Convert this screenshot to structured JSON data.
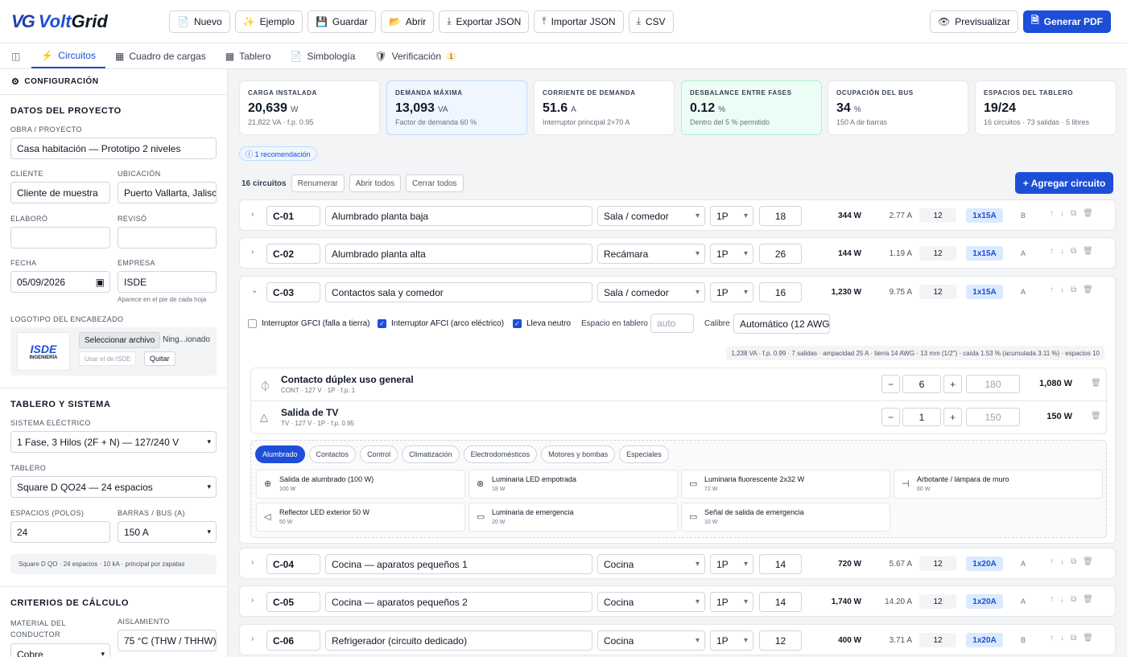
{
  "brand": {
    "mark": "VG",
    "name_a": "Volt",
    "name_b": "Grid"
  },
  "toolbar": [
    {
      "icon": "📄",
      "label": "Nuevo"
    },
    {
      "icon": "✨",
      "label": "Ejemplo"
    },
    {
      "icon": "💾",
      "label": "Guardar"
    },
    {
      "icon": "📂",
      "label": "Abrir"
    },
    {
      "icon": "⤓",
      "label": "Exportar JSON"
    },
    {
      "icon": "⤒",
      "label": "Importar JSON"
    },
    {
      "icon": "⤓",
      "label": "CSV"
    }
  ],
  "toolbar_right": {
    "preview": "Previsualizar",
    "pdf": "Generar PDF"
  },
  "tabs": [
    {
      "icon": "⚡",
      "label": "Circuitos"
    },
    {
      "icon": "▦",
      "label": "Cuadro de cargas"
    },
    {
      "icon": "▦",
      "label": "Tablero"
    },
    {
      "icon": "📄",
      "label": "Simbología"
    },
    {
      "icon": "🛡",
      "label": "Verificación",
      "badge": "1"
    }
  ],
  "sidebar": {
    "header": "CONFIGURACIÓN",
    "proyecto_title": "DATOS DEL PROYECTO",
    "obra_label": "OBRA / PROYECTO",
    "obra": "Casa habitación — Prototipo 2 niveles",
    "cliente_label": "CLIENTE",
    "cliente": "Cliente de muestra",
    "ubicacion_label": "UBICACIÓN",
    "ubicacion": "Puerto Vallarta, Jalisco",
    "elaboro_label": "ELABORÓ",
    "elaboro": "",
    "reviso_label": "REVISÓ",
    "reviso": "",
    "fecha_label": "FECHA",
    "fecha": "05/09/2026",
    "empresa_label": "EMPRESA",
    "empresa": "ISDE",
    "empresa_hint": "Aparece en el pie de cada hoja",
    "logo_label": "LOGOTIPO DEL ENCABEZADO",
    "logo_text": "ISDE",
    "logo_sub": "INGENIERÍA",
    "file_btn": "Seleccionar archivo",
    "file_name": "Ning...ionado",
    "use_isde": "Usar el de ISDE",
    "quitar": "Quitar",
    "tablero_title": "TABLERO Y SISTEMA",
    "sistema_label": "SISTEMA ELÉCTRICO",
    "sistema": "1 Fase, 3 Hilos (2F + N) — 127/240 V",
    "tablero_label": "TABLERO",
    "tablero": "Square D QO24 — 24 espacios",
    "espacios_label": "ESPACIOS (POLOS)",
    "espacios": "24",
    "barras_label": "BARRAS / BUS (A)",
    "barras": "150 A",
    "tablero_note": "Square D QO · 24 espacios · 10 kA · principal por zapatas",
    "criterios_title": "CRITERIOS DE CÁLCULO",
    "material_label": "MATERIAL DEL CONDUCTOR",
    "material": "Cobre",
    "aislamiento_label": "AISLAMIENTO",
    "aislamiento": "75 °C (THW / THHW)"
  },
  "stats": [
    {
      "title": "CARGA INSTALADA",
      "value": "20,639",
      "unit": "W",
      "sub": "21,822 VA · f.p. 0.95",
      "style": ""
    },
    {
      "title": "DEMANDA MÁXIMA",
      "value": "13,093",
      "unit": "VA",
      "sub": "Factor de demanda 60 %",
      "style": "blue"
    },
    {
      "title": "CORRIENTE DE DEMANDA",
      "value": "51.6",
      "unit": "A",
      "sub": "Interruptor principal 2×70 A",
      "style": ""
    },
    {
      "title": "DESBALANCE ENTRE FASES",
      "value": "0.12",
      "unit": "%",
      "sub": "Dentro del 5 % permitido",
      "style": "green"
    },
    {
      "title": "OCUPACIÓN DEL BUS",
      "value": "34",
      "unit": "%",
      "sub": "150 A de barras",
      "style": ""
    },
    {
      "title": "ESPACIOS DEL TABLERO",
      "value": "19/24",
      "unit": "",
      "sub": "16 circuitos · 73 salidas · 5 libres",
      "style": ""
    }
  ],
  "recommendation": "ⓘ 1 recomendación",
  "circuits_bar": {
    "count": "16 circuitos",
    "renumber": "Renumerar",
    "open_all": "Abrir todos",
    "close_all": "Cerrar todos",
    "add": "+  Agregar circuito"
  },
  "circuits": [
    {
      "code": "C-01",
      "desc": "Alumbrado planta baja",
      "area": "Sala / comedor",
      "phase": "1P",
      "num": "18",
      "watts": "344 W",
      "amps": "2.77 A",
      "gauge": "12",
      "breaker": "1x15A",
      "ph": "B",
      "chev": "›"
    },
    {
      "code": "C-02",
      "desc": "Alumbrado planta alta",
      "area": "Recámara",
      "phase": "1P",
      "num": "26",
      "watts": "144 W",
      "amps": "1.19 A",
      "gauge": "12",
      "breaker": "1x15A",
      "ph": "A",
      "chev": "›"
    },
    {
      "code": "C-03",
      "desc": "Contactos sala y comedor",
      "area": "Sala / comedor",
      "phase": "1P",
      "num": "16",
      "watts": "1,230 W",
      "amps": "9.75 A",
      "gauge": "12",
      "breaker": "1x15A",
      "ph": "A",
      "chev": "⌄"
    },
    {
      "code": "C-04",
      "desc": "Cocina — aparatos pequeños 1",
      "area": "Cocina",
      "phase": "1P",
      "num": "14",
      "watts": "720 W",
      "amps": "5.67 A",
      "gauge": "12",
      "breaker": "1x20A",
      "ph": "A",
      "chev": "›"
    },
    {
      "code": "C-05",
      "desc": "Cocina — aparatos pequeños 2",
      "area": "Cocina",
      "phase": "1P",
      "num": "14",
      "watts": "1,740 W",
      "amps": "14.20 A",
      "gauge": "12",
      "breaker": "1x20A",
      "ph": "A",
      "chev": "›"
    },
    {
      "code": "C-06",
      "desc": "Refrigerador (circuito dedicado)",
      "area": "Cocina",
      "phase": "1P",
      "num": "12",
      "watts": "400 W",
      "amps": "3.71 A",
      "gauge": "12",
      "breaker": "1x20A",
      "ph": "B",
      "chev": "›"
    }
  ],
  "expanded": {
    "gfci": "Interruptor GFCI (falla a tierra)",
    "afci": "Interruptor AFCI (arco eléctrico)",
    "neutro": "Lleva neutro",
    "espacio_label": "Espacio en tablero",
    "espacio_placeholder": "auto",
    "calibre_label": "Calibre",
    "calibre": "Automático (12 AWG)",
    "info": "1,238 VA · f.p. 0.99 · 7 salidas · ampacidad 25 A · tierra 14 AWG · 13 mm (1/2\") · caída 1.53 % (acumulada 3.11 %) · espacios 10",
    "loads": [
      {
        "icon": "⏀",
        "name": "Contacto dúplex uso general",
        "meta": "CONT · 127 V · 1P · f.p. 1",
        "qty": "6",
        "unit_w": "180",
        "total": "1,080 W"
      },
      {
        "icon": "△",
        "name": "Salida de TV",
        "meta": "TV · 127 V · 1P · f.p. 0.95",
        "qty": "1",
        "unit_w": "150",
        "total": "150 W"
      }
    ],
    "categories": [
      "Alumbrado",
      "Contactos",
      "Control",
      "Climatización",
      "Electrodomésticos",
      "Motores y bombas",
      "Especiales"
    ],
    "items": [
      {
        "icon": "⊕",
        "name": "Salida de alumbrado (100 W)",
        "w": "100 W"
      },
      {
        "icon": "⊗",
        "name": "Luminaria LED empotrada",
        "w": "18 W"
      },
      {
        "icon": "▭",
        "name": "Luminaria fluorescente 2x32 W",
        "w": "72 W"
      },
      {
        "icon": "⊣",
        "name": "Arbotante / lámpara de muro",
        "w": "60 W"
      },
      {
        "icon": "◁",
        "name": "Reflector LED exterior 50 W",
        "w": "50 W"
      },
      {
        "icon": "▭",
        "name": "Luminaria de emergencia",
        "w": "20 W"
      },
      {
        "icon": "▭",
        "name": "Señal de salida de emergencia",
        "w": "10 W"
      }
    ]
  }
}
